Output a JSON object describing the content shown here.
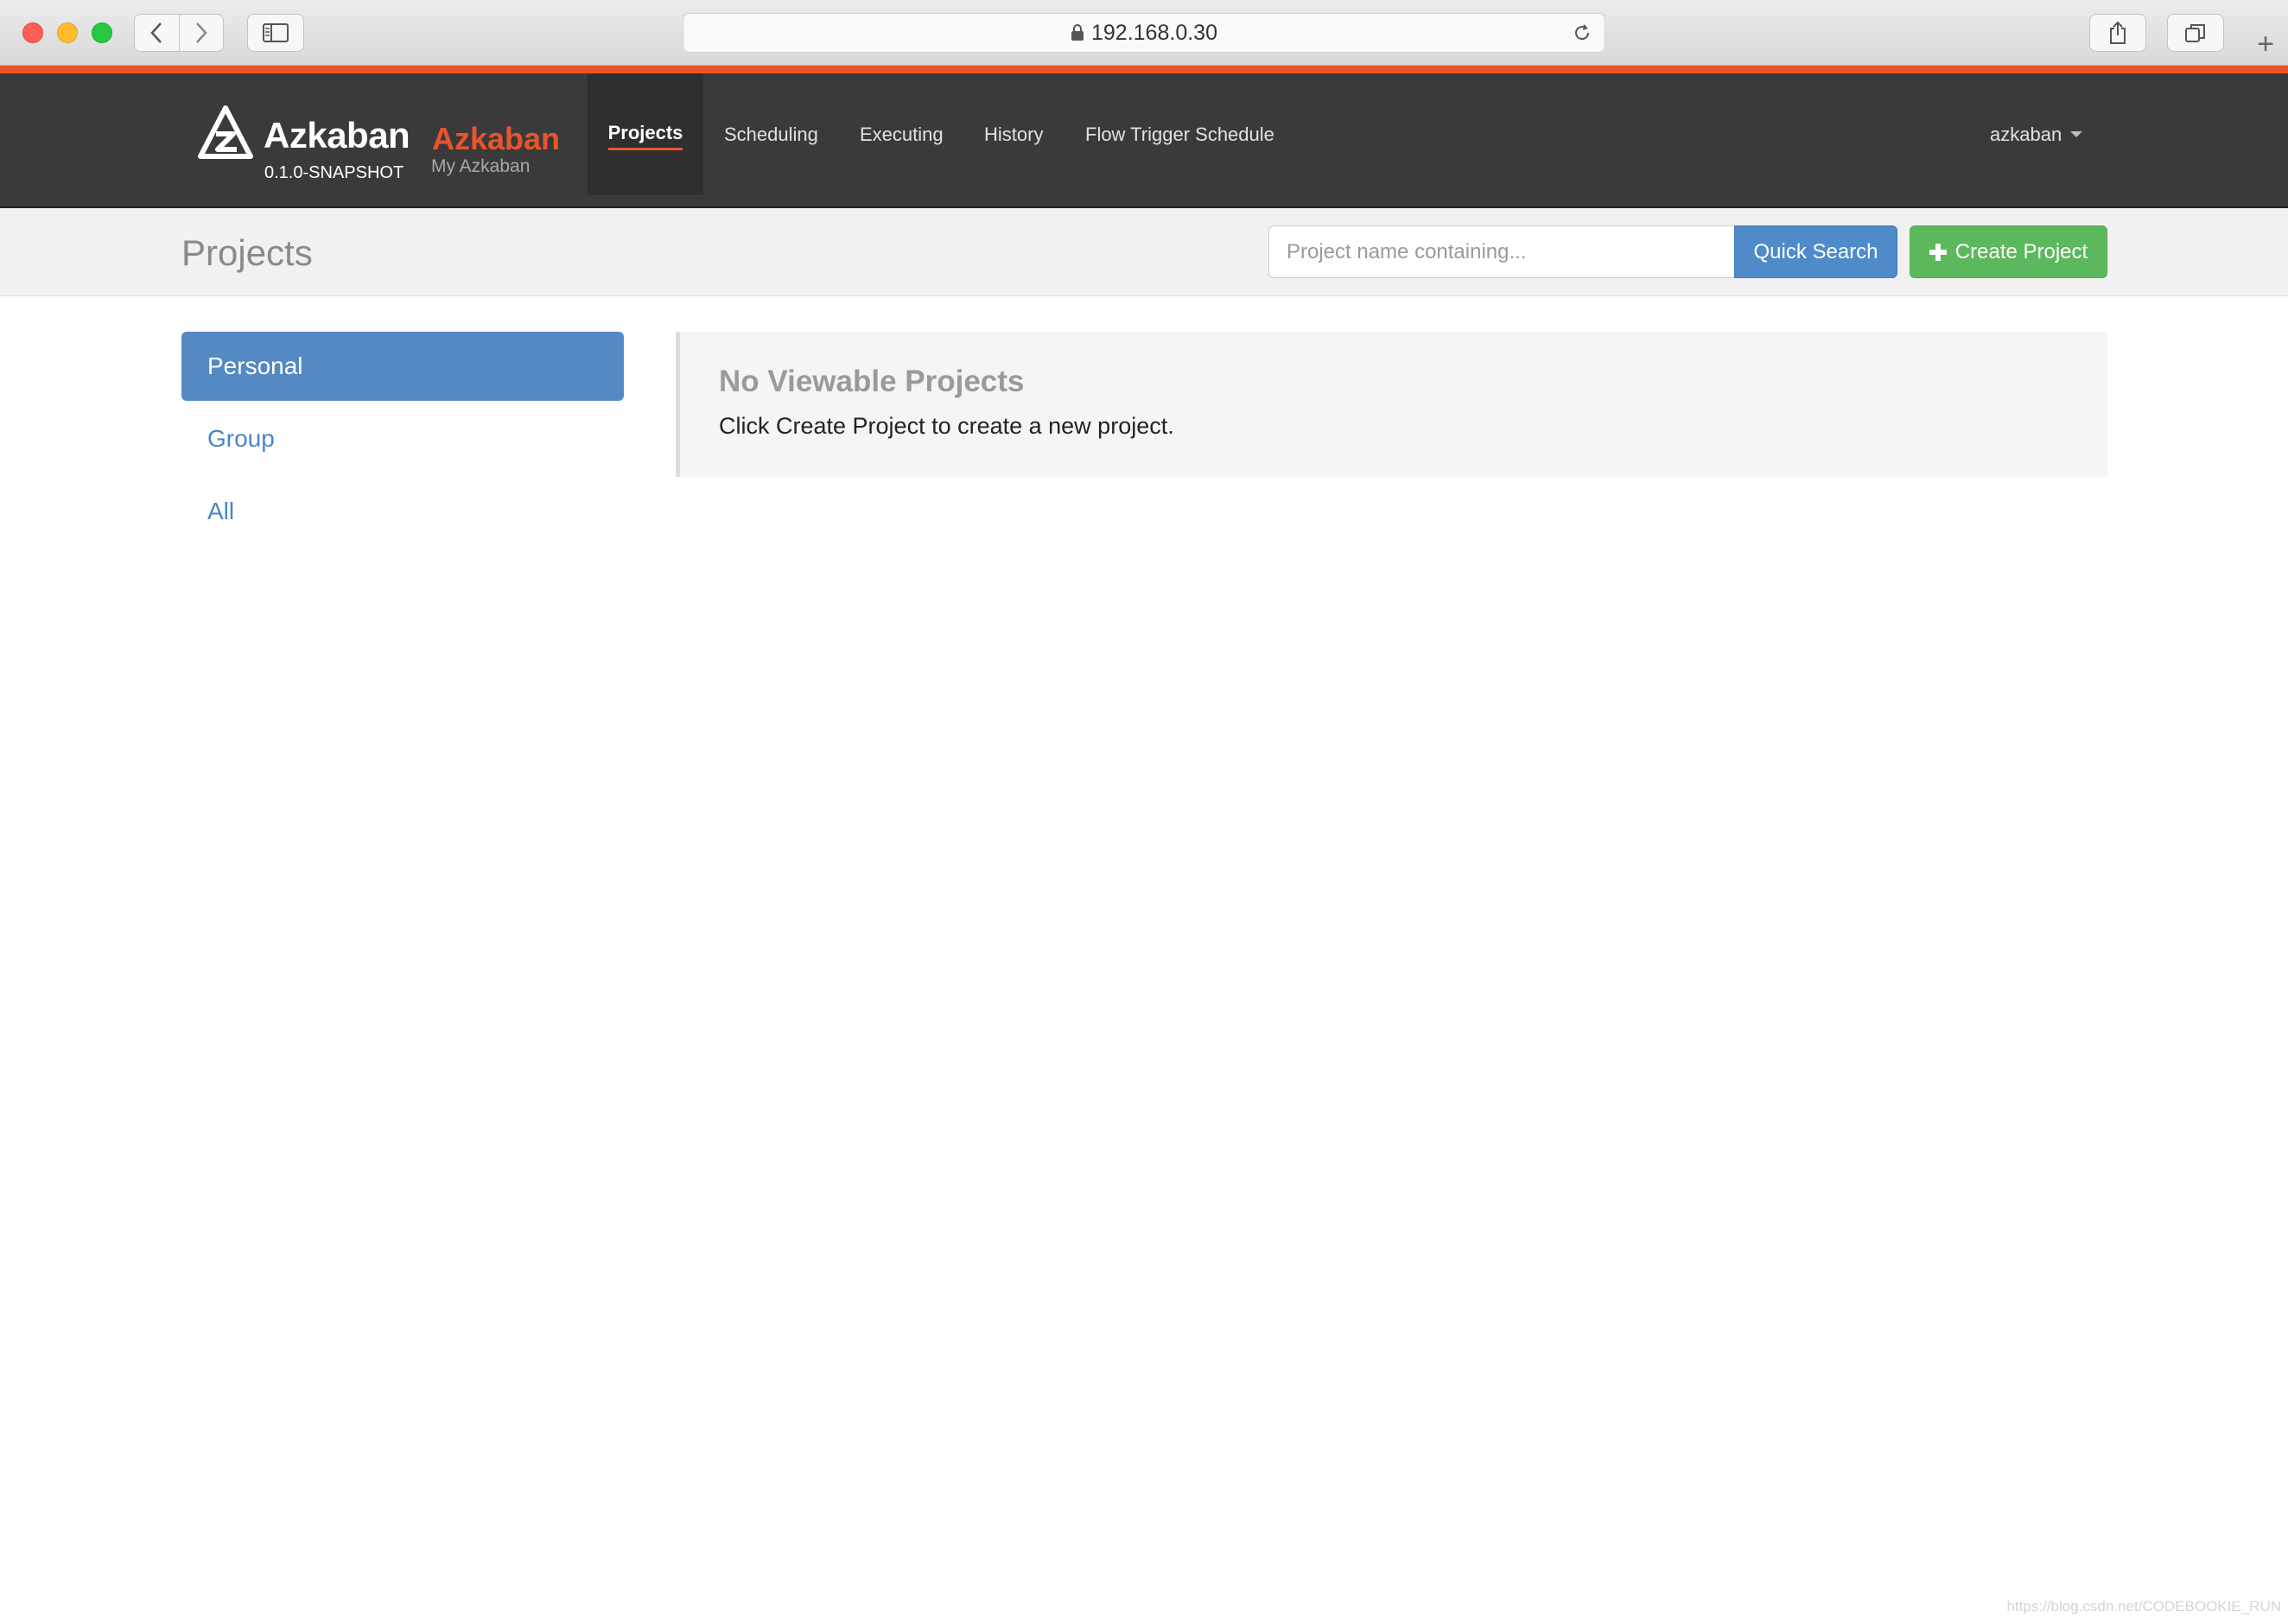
{
  "browser": {
    "url": "192.168.0.30"
  },
  "brand": {
    "name": "Azkaban",
    "version": "0.1.0-SNAPSHOT",
    "subtitle": "Azkaban",
    "subtitle_caption": "My Azkaban",
    "accent_color": "#e8552b"
  },
  "nav": {
    "items": [
      {
        "label": "Projects",
        "active": true
      },
      {
        "label": "Scheduling"
      },
      {
        "label": "Executing"
      },
      {
        "label": "History"
      },
      {
        "label": "Flow Trigger Schedule"
      }
    ],
    "user": "azkaban"
  },
  "page": {
    "title": "Projects",
    "search_placeholder": "Project name containing...",
    "search_button": "Quick Search",
    "create_button": "Create Project"
  },
  "sidebar": {
    "items": [
      {
        "label": "Personal",
        "active": true
      },
      {
        "label": "Group"
      },
      {
        "label": "All"
      }
    ]
  },
  "empty_state": {
    "title": "No Viewable Projects",
    "message": "Click Create Project to create a new project."
  },
  "footer": {
    "watermark": "https://blog.csdn.net/CODEBOOKIE_RUN"
  }
}
